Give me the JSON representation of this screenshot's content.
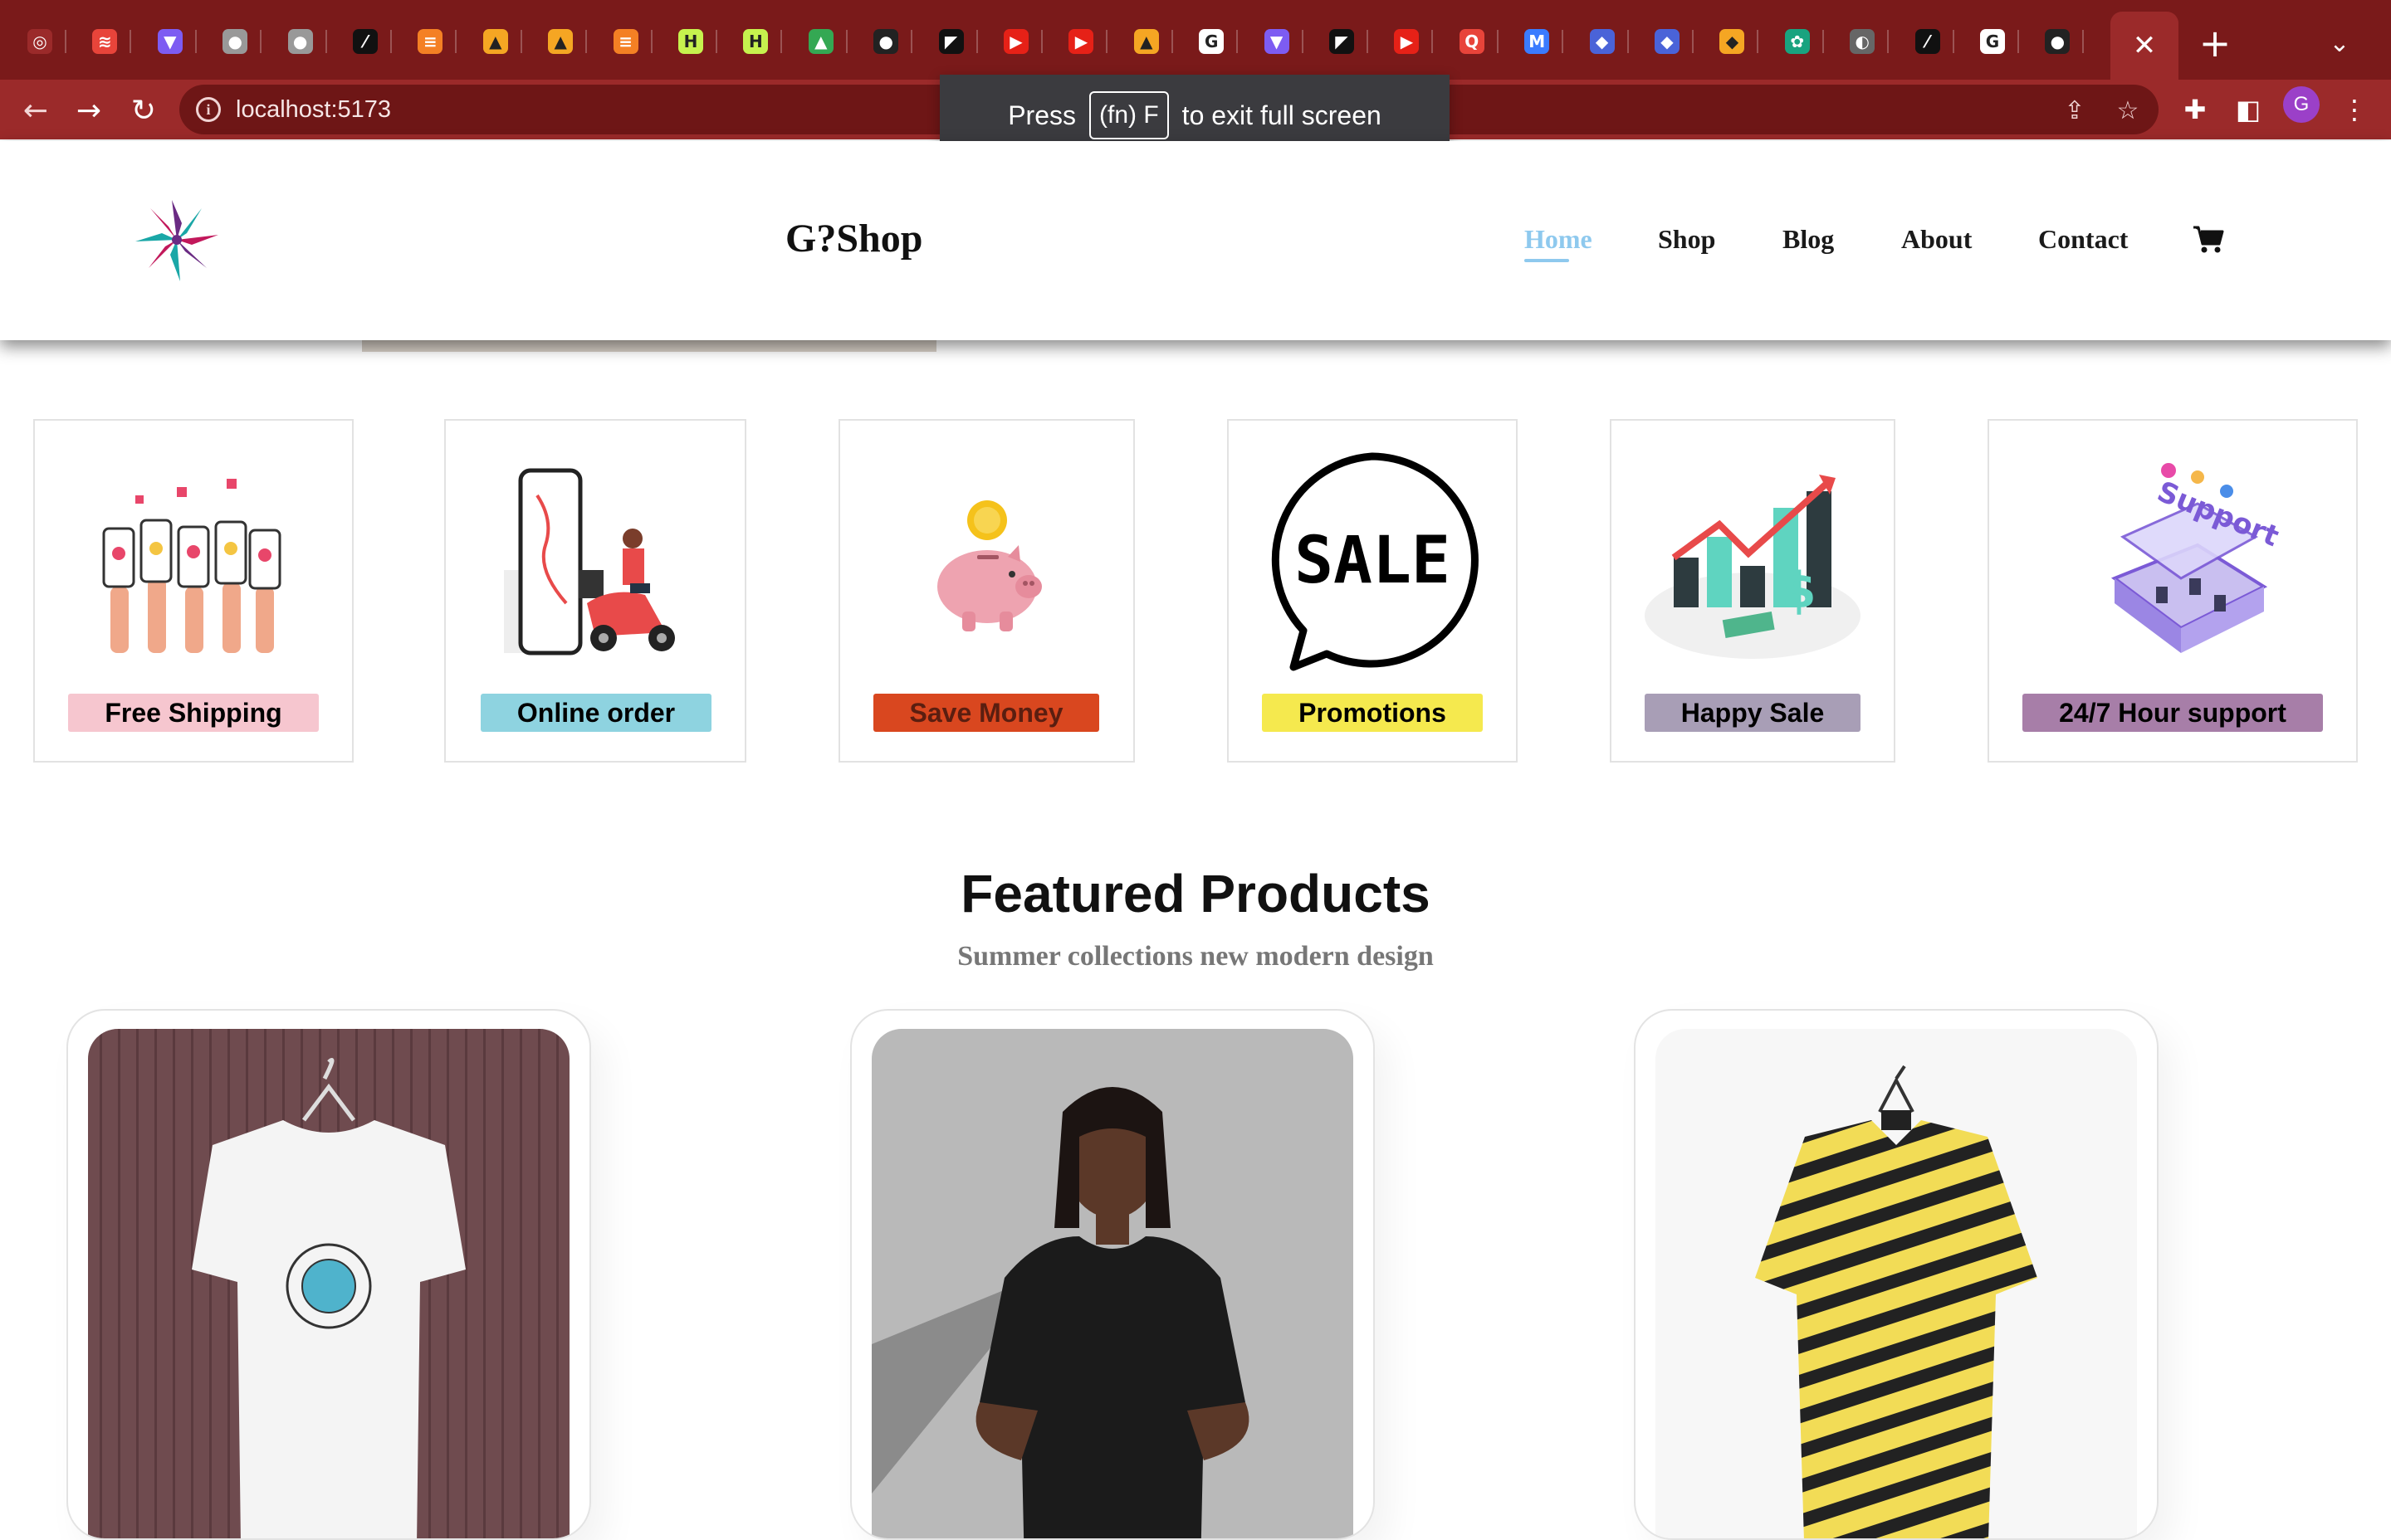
{
  "browser": {
    "tabs": [
      {
        "icon": "chrome-icon",
        "color": "#9b2a2a",
        "glyph": "◎"
      },
      {
        "icon": "laravel-icon",
        "color": "#e8443a",
        "glyph": "≋"
      },
      {
        "icon": "vite-icon",
        "color": "#7d5cf2",
        "glyph": "▼"
      },
      {
        "icon": "apple-icon",
        "color": "#999999",
        "glyph": "●"
      },
      {
        "icon": "apple-icon",
        "color": "#999999",
        "glyph": "●"
      },
      {
        "icon": "slash-icon",
        "color": "#111111",
        "glyph": "⁄"
      },
      {
        "icon": "stackoverflow-icon",
        "color": "#f48024",
        "glyph": "≡"
      },
      {
        "icon": "firebase-icon",
        "color": "#f5a623",
        "glyph": "▲"
      },
      {
        "icon": "firebase-icon",
        "color": "#f5a623",
        "glyph": "▲"
      },
      {
        "icon": "stackoverflow-icon",
        "color": "#f48024",
        "glyph": "≡"
      },
      {
        "icon": "hashnode-icon",
        "color": "#c6f24e",
        "glyph": "H"
      },
      {
        "icon": "hashnode-icon",
        "color": "#c6f24e",
        "glyph": "H"
      },
      {
        "icon": "drive-icon",
        "color": "#34a853",
        "glyph": "▲"
      },
      {
        "icon": "github-icon",
        "color": "#222222",
        "glyph": "●"
      },
      {
        "icon": "framer-icon",
        "color": "#111111",
        "glyph": "◤"
      },
      {
        "icon": "youtube-icon",
        "color": "#e62117",
        "glyph": "▶"
      },
      {
        "icon": "youtube-icon",
        "color": "#e62117",
        "glyph": "▶"
      },
      {
        "icon": "firebase-icon",
        "color": "#f5a623",
        "glyph": "▲"
      },
      {
        "icon": "google-icon",
        "color": "#ffffff",
        "glyph": "G"
      },
      {
        "icon": "vite-icon",
        "color": "#7d5cf2",
        "glyph": "▼"
      },
      {
        "icon": "framer-icon",
        "color": "#111111",
        "glyph": "◤"
      },
      {
        "icon": "youtube-icon",
        "color": "#e62117",
        "glyph": "▶"
      },
      {
        "icon": "search-app-icon",
        "color": "#e8443a",
        "glyph": "Q"
      },
      {
        "icon": "mui-icon",
        "color": "#3a7bff",
        "glyph": "M"
      },
      {
        "icon": "vercel-icon",
        "color": "#4a63d8",
        "glyph": "◆"
      },
      {
        "icon": "vercel-icon",
        "color": "#4a63d8",
        "glyph": "◆"
      },
      {
        "icon": "figma-icon",
        "color": "#f5a623",
        "glyph": "◆"
      },
      {
        "icon": "openai-icon",
        "color": "#19a37f",
        "glyph": "✿"
      },
      {
        "icon": "globe-icon",
        "color": "#666666",
        "glyph": "◐"
      },
      {
        "icon": "slash-icon",
        "color": "#111111",
        "glyph": "⁄"
      },
      {
        "icon": "google-icon",
        "color": "#ffffff",
        "glyph": "G"
      },
      {
        "icon": "github-icon",
        "color": "#222222",
        "glyph": "●"
      }
    ],
    "active_tab_close": "✕",
    "new_tab": "+",
    "tab_menu": "⌄",
    "url": "localhost:5173",
    "avatar_letter": "G",
    "fullscreen_toast": {
      "before": "Press",
      "key": "(fn) F",
      "after": "to exit full screen"
    }
  },
  "site": {
    "brand": "G?Shop",
    "nav": [
      {
        "label": "Home",
        "active": true
      },
      {
        "label": "Shop",
        "active": false
      },
      {
        "label": "Blog",
        "active": false
      },
      {
        "label": "About",
        "active": false
      },
      {
        "label": "Contact",
        "active": false
      }
    ],
    "features": [
      {
        "label": "Free Shipping",
        "color": "#f6c6cf"
      },
      {
        "label": "Online order",
        "color": "#8ed3e0"
      },
      {
        "label": "Save Money",
        "color": "#d9471f"
      },
      {
        "label": "Promotions",
        "color": "#f5e94e"
      },
      {
        "label": "Happy Sale",
        "color": "#a89eb6"
      },
      {
        "label": "24/7 Hour support",
        "color": "#a77ea8"
      }
    ],
    "sale_text": "SALE",
    "support_text": "Support",
    "featured": {
      "title": "Featured Products",
      "subtitle": "Summer collections new modern design"
    },
    "products": [
      {
        "image": "white graphic t-shirt on hanger"
      },
      {
        "image": "woman in black beautiful t-shirt"
      },
      {
        "image": "yellow warning-print shirt on hanger"
      }
    ]
  }
}
